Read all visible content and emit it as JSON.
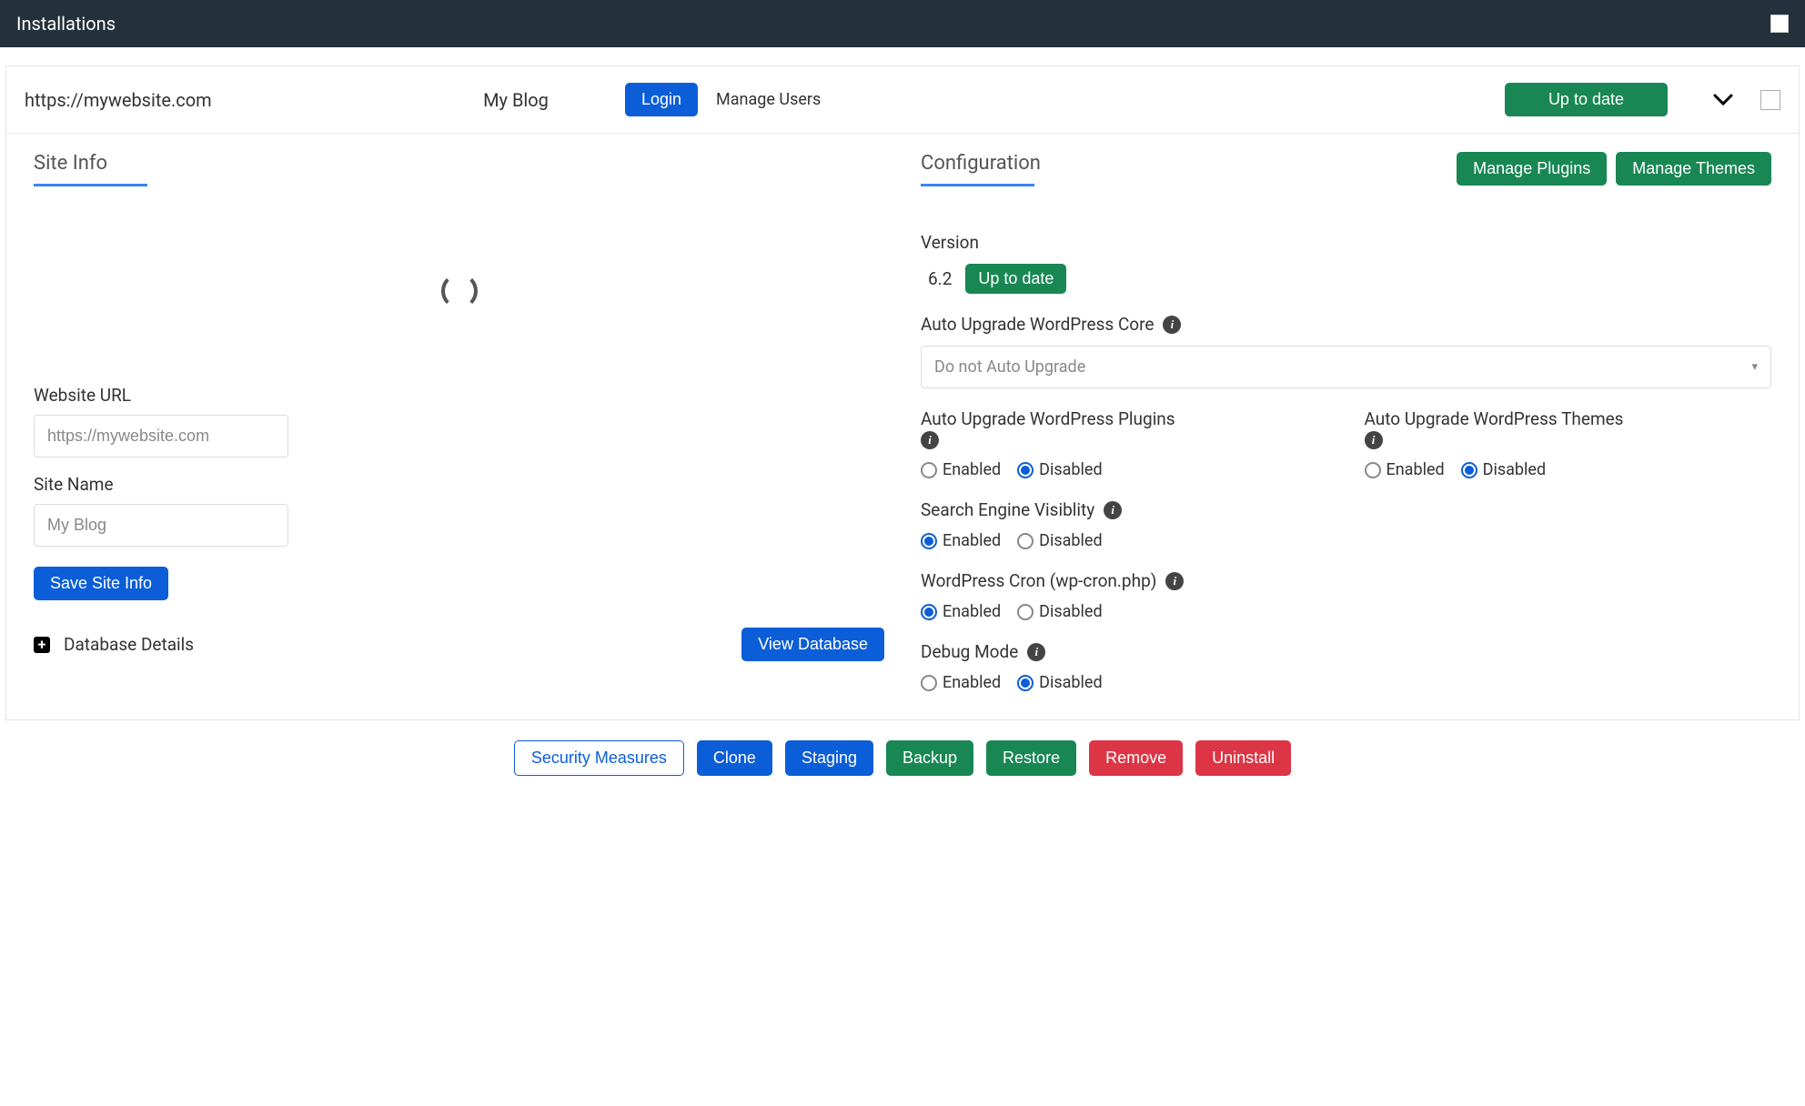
{
  "header": {
    "title": "Installations"
  },
  "row": {
    "url": "https://mywebsite.com",
    "name": "My Blog",
    "login": "Login",
    "manage_users": "Manage Users",
    "status": "Up to date"
  },
  "site_info": {
    "title": "Site Info",
    "website_url_label": "Website URL",
    "website_url_value": "https://mywebsite.com",
    "site_name_label": "Site Name",
    "site_name_value": "My Blog",
    "save": "Save Site Info",
    "db_details": "Database Details",
    "view_db": "View Database"
  },
  "config": {
    "title": "Configuration",
    "manage_plugins": "Manage Plugins",
    "manage_themes": "Manage Themes",
    "version_label": "Version",
    "version_value": "6.2",
    "version_status": "Up to date",
    "auto_core_label": "Auto Upgrade WordPress Core",
    "auto_core_value": "Do not Auto Upgrade",
    "auto_plugins_label": "Auto Upgrade WordPress Plugins",
    "auto_themes_label": "Auto Upgrade WordPress Themes",
    "search_label": "Search Engine Visiblity",
    "cron_label": "WordPress Cron (wp-cron.php)",
    "debug_label": "Debug Mode",
    "enabled": "Enabled",
    "disabled": "Disabled"
  },
  "actions": {
    "security": "Security Measures",
    "clone": "Clone",
    "staging": "Staging",
    "backup": "Backup",
    "restore": "Restore",
    "remove": "Remove",
    "uninstall": "Uninstall"
  }
}
